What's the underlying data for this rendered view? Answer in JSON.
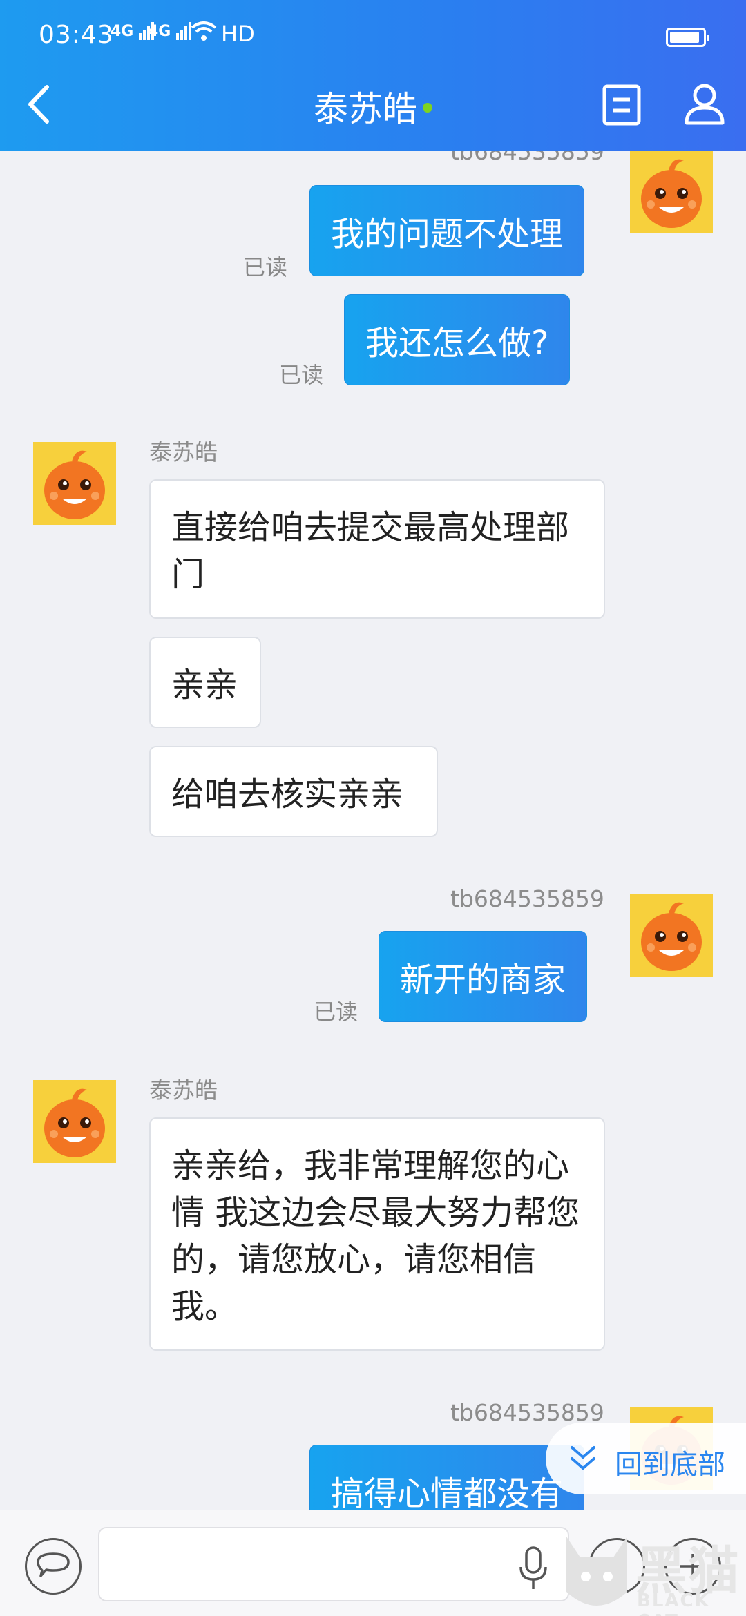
{
  "status_bar": {
    "time": "03:43",
    "signal1": "4G",
    "signal2": "4G",
    "hd": "HD"
  },
  "header": {
    "title": "泰苏皓",
    "online": true
  },
  "chat": {
    "read_label": "已读",
    "self_name": "tb684535859",
    "other_name": "泰苏皓",
    "messages": [
      {
        "from": "self",
        "text": "我的问题不处理",
        "read": "已读"
      },
      {
        "from": "self",
        "text": "我还怎么做?",
        "read": "已读"
      },
      {
        "from": "other",
        "sender": "泰苏皓",
        "text": "直接给咱去提交最高处理部门"
      },
      {
        "from": "other",
        "text": "亲亲"
      },
      {
        "from": "other",
        "text": "给咱去核实亲亲"
      },
      {
        "from": "self",
        "sender": "tb684535859",
        "text": "新开的商家",
        "read": "已读"
      },
      {
        "from": "other",
        "sender": "泰苏皓",
        "text": "亲亲给，我非常理解您的心情 我这边会尽最大努力帮您的，请您放心，请您相信我。"
      },
      {
        "from": "self",
        "sender": "tb684535859",
        "text": "搞得心情都没有"
      }
    ]
  },
  "back_to_bottom": "回到底部",
  "watermark": {
    "cn": "黑猫",
    "en": "BLACK CAT"
  },
  "colors": {
    "accent": "#2a86ef",
    "bubble_out": "#1e9bf0",
    "online": "#7ed321"
  }
}
